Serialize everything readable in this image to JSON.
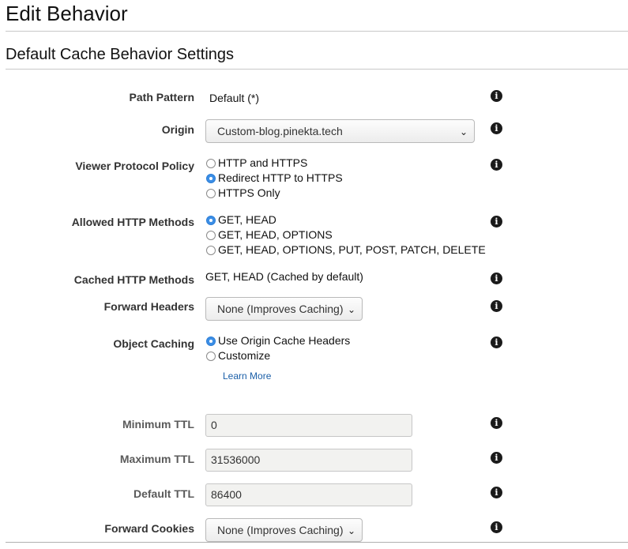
{
  "header": {
    "title": "Edit Behavior"
  },
  "section": {
    "title": "Default Cache Behavior Settings"
  },
  "fields": {
    "path_pattern": {
      "label": "Path Pattern",
      "value": "Default (*)"
    },
    "origin": {
      "label": "Origin",
      "value": "Custom-blog.pinekta.tech"
    },
    "viewer_protocol": {
      "label": "Viewer Protocol Policy",
      "options": [
        "HTTP and HTTPS",
        "Redirect HTTP to HTTPS",
        "HTTPS Only"
      ],
      "selected": "Redirect HTTP to HTTPS"
    },
    "allowed_methods": {
      "label": "Allowed HTTP Methods",
      "options": [
        "GET, HEAD",
        "GET, HEAD, OPTIONS",
        "GET, HEAD, OPTIONS, PUT, POST, PATCH, DELETE"
      ],
      "selected": "GET, HEAD"
    },
    "cached_methods": {
      "label": "Cached HTTP Methods",
      "value": "GET, HEAD (Cached by default)"
    },
    "forward_headers": {
      "label": "Forward Headers",
      "value": "None (Improves Caching)"
    },
    "object_caching": {
      "label": "Object Caching",
      "options": [
        "Use Origin Cache Headers",
        "Customize"
      ],
      "selected": "Use Origin Cache Headers",
      "link": "Learn More"
    },
    "min_ttl": {
      "label": "Minimum TTL",
      "value": "0"
    },
    "max_ttl": {
      "label": "Maximum TTL",
      "value": "31536000"
    },
    "default_ttl": {
      "label": "Default TTL",
      "value": "86400"
    },
    "forward_cookies": {
      "label": "Forward Cookies",
      "value": "None (Improves Caching)"
    }
  },
  "icons": {
    "info": "info-icon",
    "chevron": "chevron-down-icon",
    "info_glyph": "i",
    "chevron_glyph": "⌄"
  },
  "colors": {
    "accent": "#3b8ee6",
    "link": "#1b5fa8"
  }
}
